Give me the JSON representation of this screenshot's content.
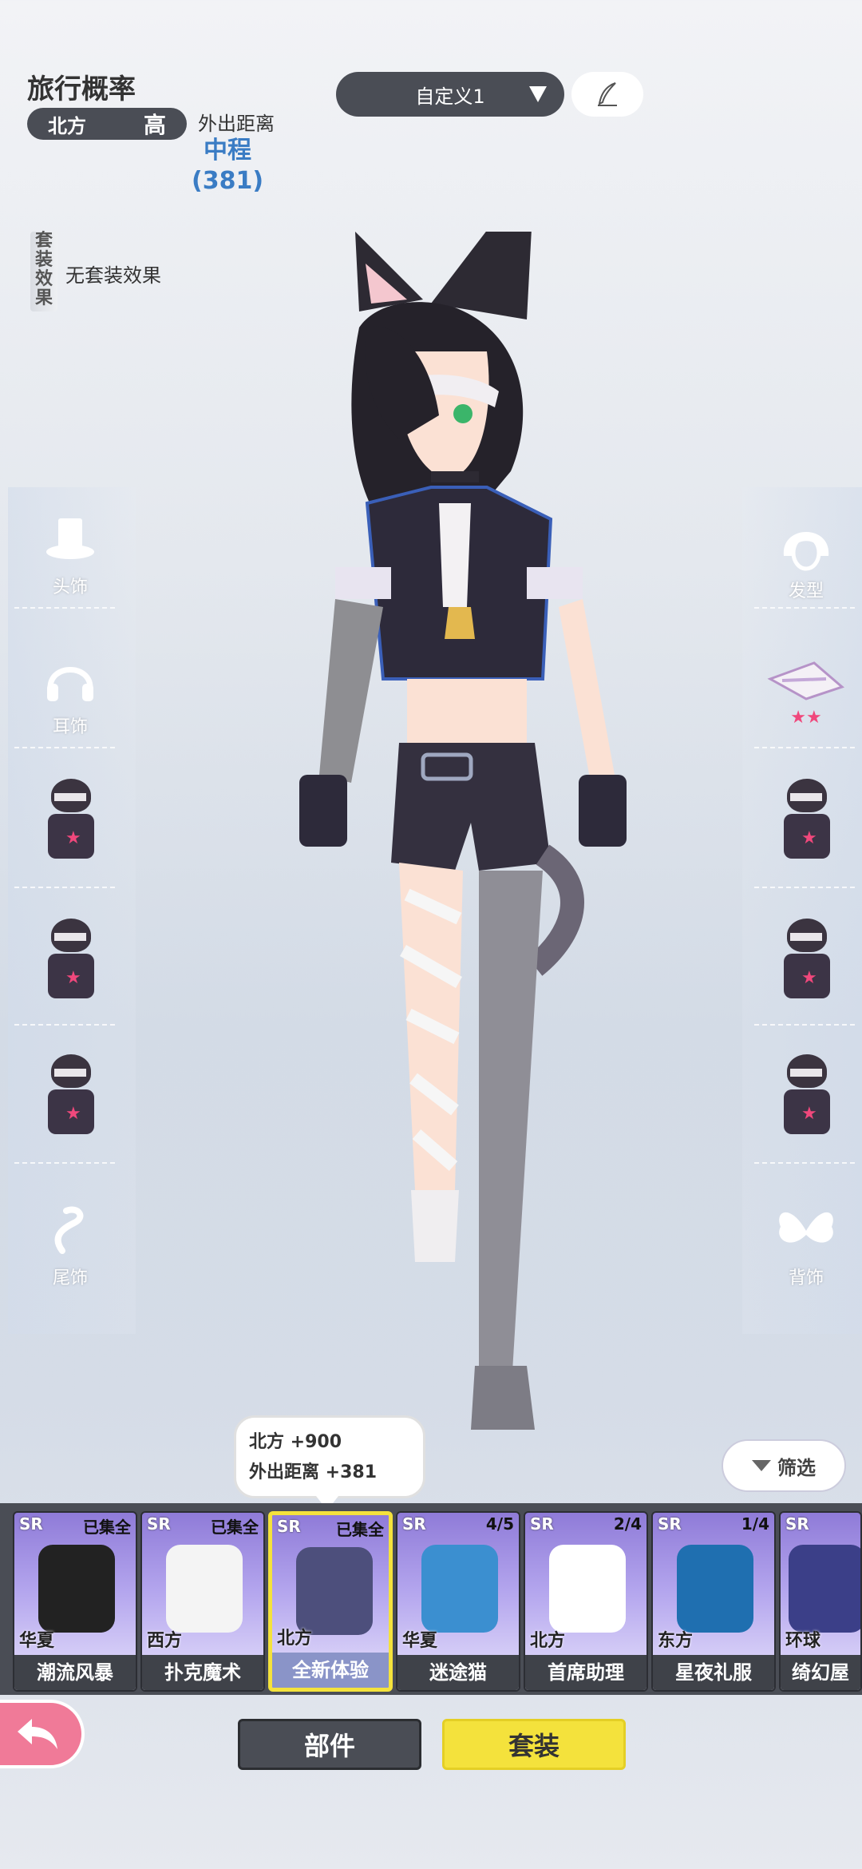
{
  "travel": {
    "title": "旅行概率",
    "direction": "北方",
    "level": "高",
    "distance_label": "外出距离",
    "distance_value": "中程",
    "distance_number": "(381)"
  },
  "set_effect": {
    "label_chars": [
      "套",
      "装",
      "效",
      "果"
    ],
    "text": "无套装效果"
  },
  "preset": {
    "label": "自定义1"
  },
  "left_slots": [
    {
      "label": "头饰",
      "icon": "hat-icon"
    },
    {
      "label": "耳饰",
      "icon": "headphones-icon"
    },
    {
      "label": "",
      "icon": "outfit-thumb"
    },
    {
      "label": "",
      "icon": "outfit-thumb"
    },
    {
      "label": "",
      "icon": "outfit-thumb"
    },
    {
      "label": "尾饰",
      "icon": "tail-icon"
    }
  ],
  "right_slots": [
    {
      "label": "发型",
      "icon": "hair-icon"
    },
    {
      "label": "",
      "icon": "accessory-thumb",
      "stars": "★★"
    },
    {
      "label": "",
      "icon": "outfit-thumb"
    },
    {
      "label": "",
      "icon": "outfit-thumb"
    },
    {
      "label": "",
      "icon": "outfit-thumb"
    },
    {
      "label": "背饰",
      "icon": "wings-icon"
    }
  ],
  "tooltip": {
    "line1": "北方 +900",
    "line2": "外出距离 +381"
  },
  "filter": {
    "label": "筛选"
  },
  "cards": [
    {
      "rarity": "SR",
      "status": "已集全",
      "region": "华夏",
      "name": "潮流风暴",
      "selected": false,
      "color": "#222"
    },
    {
      "rarity": "SR",
      "status": "已集全",
      "region": "西方",
      "name": "扑克魔术",
      "selected": false,
      "color": "#f4f4f4"
    },
    {
      "rarity": "SR",
      "status": "已集全",
      "region": "北方",
      "name": "全新体验",
      "selected": true,
      "color": "#4d4f7c"
    },
    {
      "rarity": "SR",
      "status": "4/5",
      "region": "华夏",
      "name": "迷途猫",
      "selected": false,
      "color": "#3b8fd0"
    },
    {
      "rarity": "SR",
      "status": "2/4",
      "region": "北方",
      "name": "首席助理",
      "selected": false,
      "color": "#ffffff"
    },
    {
      "rarity": "SR",
      "status": "1/4",
      "region": "东方",
      "name": "星夜礼服",
      "selected": false,
      "color": "#1f6fb0"
    },
    {
      "rarity": "SR",
      "status": "",
      "region": "环球",
      "name": "绮幻屋",
      "selected": false,
      "color": "#3b3f88"
    }
  ],
  "tabs": {
    "parts": "部件",
    "set": "套装"
  }
}
